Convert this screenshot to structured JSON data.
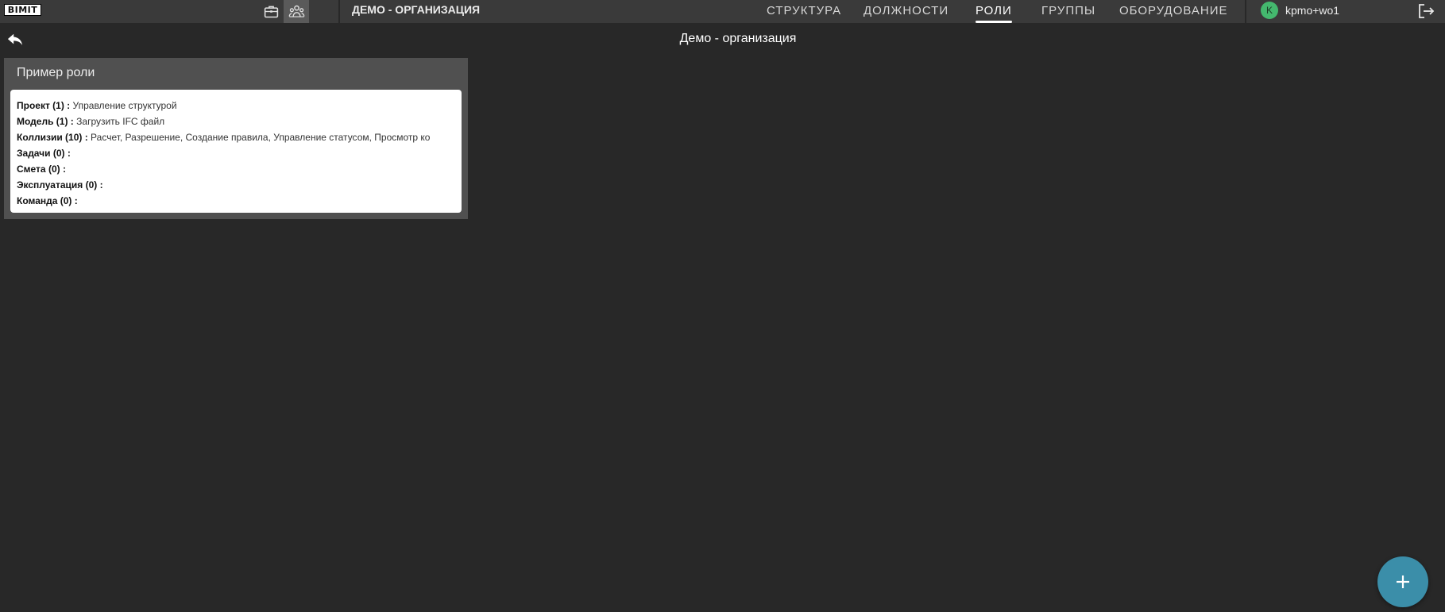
{
  "header": {
    "logo_text": "BIMIT",
    "org_title": "ДЕМО - ОРГАНИЗАЦИЯ",
    "nav": [
      {
        "label": "СТРУКТУРА"
      },
      {
        "label": "ДОЛЖНОСТИ"
      },
      {
        "label": "РОЛИ"
      },
      {
        "label": "ГРУППЫ"
      },
      {
        "label": "ОБОРУДОВАНИЕ"
      }
    ],
    "active_tab": "РОЛИ",
    "user": {
      "initial": "K",
      "name": "kpmo+wo1",
      "avatar_color": "#44b86e"
    }
  },
  "page": {
    "title": "Демо - организация"
  },
  "role_card": {
    "title": "Пример роли",
    "permissions": [
      {
        "label": "Проект (1) :",
        "value": "Управление структурой"
      },
      {
        "label": "Модель (1) :",
        "value": "Загрузить IFC файл"
      },
      {
        "label": "Коллизии (10) :",
        "value": "Расчет, Разрешение, Создание правила, Управление статусом, Просмотр ко"
      },
      {
        "label": "Задачи (0) :",
        "value": ""
      },
      {
        "label": "Смета (0) :",
        "value": ""
      },
      {
        "label": "Эксплуатация (0) :",
        "value": ""
      },
      {
        "label": "Команда (0) :",
        "value": ""
      }
    ]
  },
  "colors": {
    "background": "#282828",
    "topbar": "#3a3a3a",
    "card": "#505050",
    "fab": "#3b8ea9"
  },
  "icons": {
    "work_mode": "briefcase-icon",
    "people_mode": "people-icon",
    "logout": "logout-icon",
    "back": "reply-arrow-icon",
    "fab": "plus-icon"
  }
}
